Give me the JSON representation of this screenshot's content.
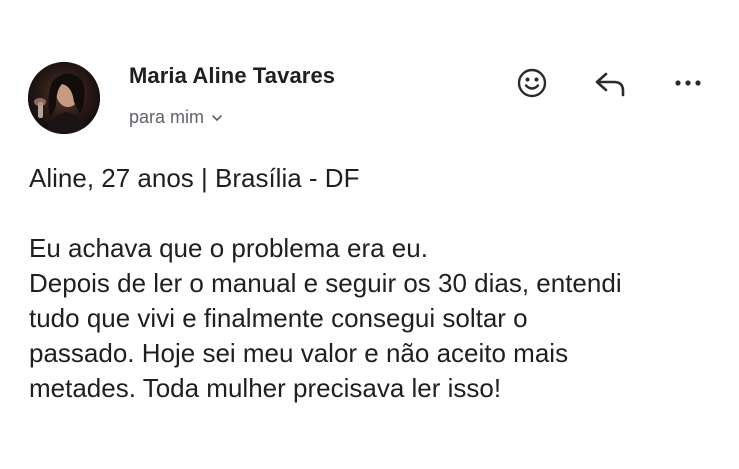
{
  "email": {
    "sender_name": "Maria Aline Tavares",
    "recipient_label": "para mim",
    "body_lines": [
      "Aline, 27 anos | Brasília - DF",
      "",
      "Eu achava que o problema era eu.",
      "Depois de ler o manual e seguir os 30 dias, entendi",
      "tudo que vivi e finalmente consegui soltar o",
      "passado. Hoje sei meu valor e não aceito mais",
      "metades. Toda mulher precisava ler isso!"
    ]
  },
  "icons": {
    "avatar": "avatar-photo",
    "recipient_toggle": "chevron-down-icon",
    "react": "smiley-icon",
    "reply": "reply-icon",
    "more": "more-horizontal-icon"
  },
  "colors": {
    "text_primary": "#1f1f1f",
    "text_secondary": "#5f6368",
    "background": "#ffffff"
  }
}
